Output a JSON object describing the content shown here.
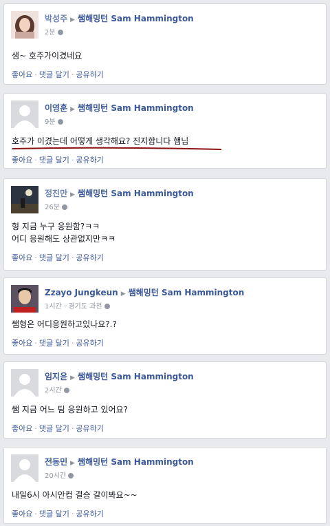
{
  "posts": [
    {
      "author": "박성주",
      "target": "쌤해밍턴 Sam Hammington",
      "time": "2분",
      "location": "",
      "lines": [
        "샘~ 호주가이겼네요"
      ],
      "actions": {
        "like": "좋아요",
        "comment": "댓글 달기",
        "share": "공유하기"
      },
      "avatar": "photo-girl"
    },
    {
      "author": "이영훈",
      "target": "쌤해밍턴 Sam Hammington",
      "time": "9분",
      "location": "",
      "lines": [
        "호주가 이겼는데 어떻게 생각해요? 진지합니다 햄님"
      ],
      "actions": {
        "like": "좋아요",
        "comment": "댓글 달기",
        "share": "공유하기"
      },
      "avatar": "default"
    },
    {
      "author": "정진만",
      "target": "쌤해밍턴 Sam Hammington",
      "time": "26분",
      "location": "",
      "lines": [
        "형 지금 누구 응원함?ㅋㅋ",
        "어디 응원해도 상관없지만ㅋㅋ"
      ],
      "actions": {
        "like": "좋아요",
        "comment": "댓글 달기",
        "share": "공유하기"
      },
      "avatar": "photo-night"
    },
    {
      "author": "Zzayo Jungkeun",
      "target": "쌤해밍턴 Sam Hammington",
      "time": "1시간",
      "location": "경기도 과천",
      "lines": [
        "쌤형은 어디응원하고있나요?.?"
      ],
      "actions": {
        "like": "좋아요",
        "comment": "댓글 달기",
        "share": "공유하기"
      },
      "avatar": "photo-man"
    },
    {
      "author": "임지윤",
      "target": "쌤해밍턴 Sam Hammington",
      "time": "2시간",
      "location": "",
      "lines": [
        "쌤 지금 어느 팀 응원하고 있어요?"
      ],
      "actions": {
        "like": "좋아요",
        "comment": "댓글 달기",
        "share": "공유하기"
      },
      "avatar": "default"
    },
    {
      "author": "전동민",
      "target": "쌤해밍턴 Sam Hammington",
      "time": "20시간",
      "location": "",
      "lines": [
        "내일6시 아시안컵 결승 갈이봐요~~"
      ],
      "actions": {
        "like": "좋아요",
        "comment": "댓글 달기",
        "share": "공유하기"
      },
      "avatar": "default"
    }
  ]
}
